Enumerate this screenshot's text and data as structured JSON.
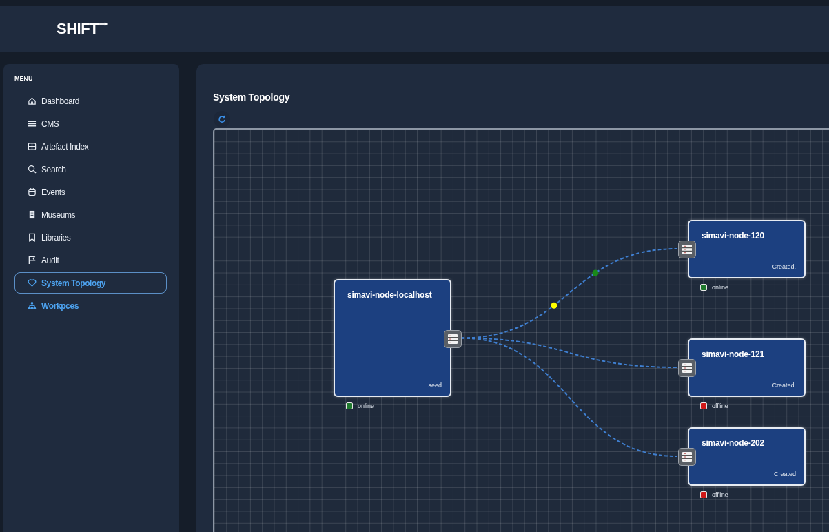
{
  "header": {
    "logo": "SHIFT"
  },
  "sidebar": {
    "heading": "MENU",
    "items": [
      {
        "label": "Dashboard",
        "selected": false,
        "highlighted": false
      },
      {
        "label": "CMS",
        "selected": false,
        "highlighted": false
      },
      {
        "label": "Artefact Index",
        "selected": false,
        "highlighted": false
      },
      {
        "label": "Search",
        "selected": false,
        "highlighted": false
      },
      {
        "label": "Events",
        "selected": false,
        "highlighted": false
      },
      {
        "label": "Museums",
        "selected": false,
        "highlighted": false
      },
      {
        "label": "Libraries",
        "selected": false,
        "highlighted": false
      },
      {
        "label": "Audit",
        "selected": false,
        "highlighted": false
      },
      {
        "label": "System Topology",
        "selected": true,
        "highlighted": true
      },
      {
        "label": "Workpces",
        "selected": false,
        "highlighted": true
      }
    ]
  },
  "main": {
    "title": "System Topology",
    "topology": {
      "nodes": [
        {
          "name": "simavi-node-localhost",
          "note": "seed",
          "status": {
            "label": "online",
            "color": "#1f7a2e"
          }
        },
        {
          "name": "simavi-node-120",
          "note": "Created.",
          "status": {
            "label": "online",
            "color": "#1f7a2e"
          }
        },
        {
          "name": "simavi-node-121",
          "note": "Created.",
          "status": {
            "label": "offline",
            "color": "#d01818"
          }
        },
        {
          "name": "simavi-node-202",
          "note": "Created",
          "status": {
            "label": "offline",
            "color": "#d01818"
          }
        }
      ],
      "edges": [
        {
          "kind": "dashed",
          "markers": [
            {
              "color": "#ffff00"
            },
            {
              "color": "#1a8a1a"
            }
          ]
        },
        {
          "kind": "dashed"
        },
        {
          "kind": "dashed"
        }
      ]
    }
  }
}
